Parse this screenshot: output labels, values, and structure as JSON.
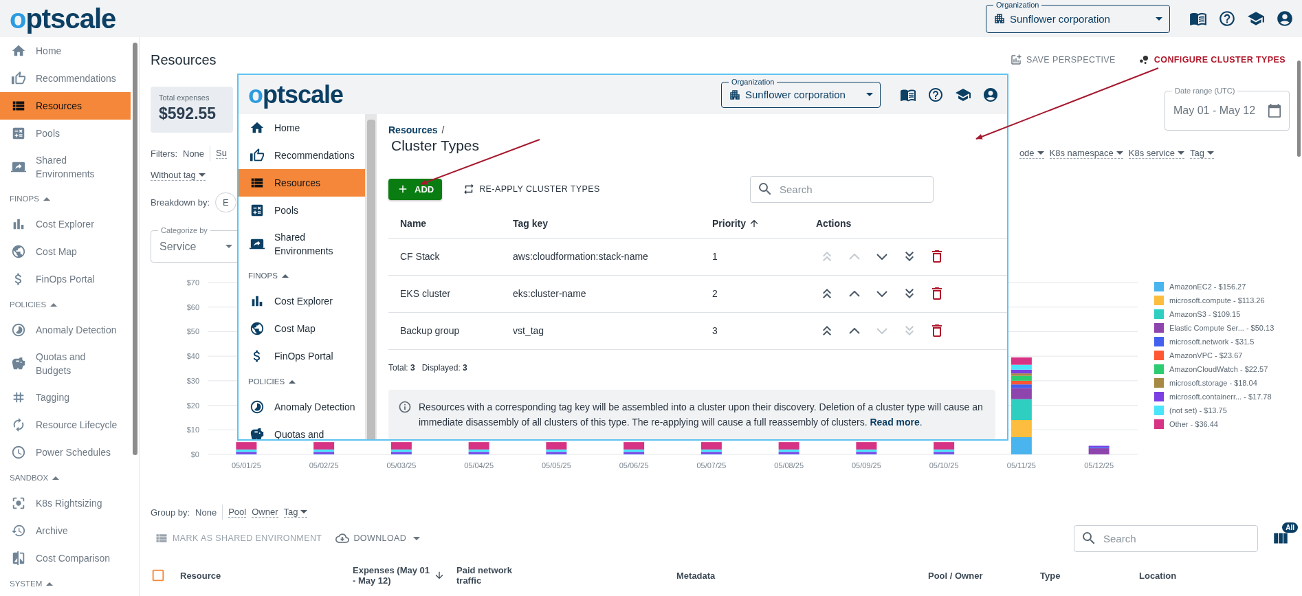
{
  "topbar": {
    "logo": "optscale",
    "organization_label": "Organization",
    "organization": "Sunflower corporation"
  },
  "sidebar": {
    "items": [
      {
        "kind": "item",
        "label": "Home",
        "selected": false
      },
      {
        "kind": "item",
        "label": "Recommendations",
        "selected": false
      },
      {
        "kind": "item",
        "label": "Resources",
        "selected": true
      },
      {
        "kind": "item",
        "label": "Pools",
        "selected": false
      },
      {
        "kind": "item",
        "label": "Shared Environments",
        "selected": false
      },
      {
        "kind": "section",
        "label": "FINOPS"
      },
      {
        "kind": "item",
        "label": "Cost Explorer",
        "selected": false
      },
      {
        "kind": "item",
        "label": "Cost Map",
        "selected": false
      },
      {
        "kind": "item",
        "label": "FinOps Portal",
        "selected": false
      },
      {
        "kind": "section",
        "label": "POLICIES"
      },
      {
        "kind": "item",
        "label": "Anomaly Detection",
        "selected": false
      },
      {
        "kind": "item",
        "label": "Quotas and Budgets",
        "selected": false
      },
      {
        "kind": "item",
        "label": "Tagging",
        "selected": false
      },
      {
        "kind": "item",
        "label": "Resource Lifecycle",
        "selected": false
      },
      {
        "kind": "item",
        "label": "Power Schedules",
        "selected": false
      },
      {
        "kind": "section",
        "label": "SANDBOX"
      },
      {
        "kind": "item",
        "label": "K8s Rightsizing",
        "selected": false
      },
      {
        "kind": "item",
        "label": "Archive",
        "selected": false
      },
      {
        "kind": "item",
        "label": "Cost Comparison",
        "selected": false
      },
      {
        "kind": "section",
        "label": "SYSTEM"
      }
    ]
  },
  "page": {
    "title": "Resources",
    "save_perspective": "SAVE PERSPECTIVE",
    "configure": "CONFIGURE CLUSTER TYPES",
    "total_expenses": {
      "label": "Total expenses",
      "value": "$592.55"
    },
    "date_range": {
      "label": "Date range (UTC)",
      "value": "May 01 - May 12"
    },
    "filters": {
      "label": "Filters:",
      "value": "None",
      "left": [
        "Su"
      ],
      "right": [
        "ode",
        "K8s namespace",
        "K8s service",
        "Tag"
      ]
    },
    "without_tag": "Without tag",
    "breakdown": {
      "label": "Breakdown by:",
      "value": "E"
    },
    "categorize": {
      "label": "Categorize by",
      "value": "Service"
    },
    "chart_data": {
      "type": "bar",
      "stacked": true,
      "ylim": [
        0,
        70
      ],
      "grid": true,
      "legend": "right",
      "categories": [
        "05/01/25",
        "05/02/25",
        "05/03/25",
        "05/04/25",
        "05/05/25",
        "05/06/25",
        "05/07/25",
        "05/08/25",
        "05/09/25",
        "05/10/25",
        "05/11/25",
        "05/12/25"
      ],
      "yticks": [
        {
          "value": 0,
          "label": "$0"
        },
        {
          "value": 10,
          "label": "$10"
        },
        {
          "value": 20,
          "label": "$20"
        },
        {
          "value": 30,
          "label": "$30"
        },
        {
          "value": 40,
          "label": "$40"
        },
        {
          "value": 50,
          "label": "$50"
        },
        {
          "value": 60,
          "label": "$60"
        },
        {
          "value": 70,
          "label": "$70"
        }
      ],
      "series": [
        {
          "name": "AmazonEC2 - $156.27",
          "color": "#4ab4ee",
          "values": [
            0,
            0,
            0,
            0,
            0,
            0,
            0,
            0,
            0,
            0,
            7,
            0
          ]
        },
        {
          "name": "microsoft.compute - $113.26",
          "color": "#fdbd3e",
          "values": [
            0,
            0,
            0,
            0,
            0,
            0,
            0,
            0,
            0,
            0,
            7,
            0
          ]
        },
        {
          "name": "AmazonS3 - $109.15",
          "color": "#2ecfc1",
          "values": [
            0,
            0,
            0,
            0,
            0,
            0,
            0,
            0,
            0,
            0,
            8.5,
            0
          ]
        },
        {
          "name": "Elastic Compute Ser... - $50.13",
          "color": "#8e44ad",
          "values": [
            0,
            0,
            0,
            0,
            0,
            0,
            0,
            0,
            0,
            0,
            4.5,
            2.5
          ]
        },
        {
          "name": "microsoft.network - $31.5",
          "color": "#4361ee",
          "values": [
            0.3,
            0.3,
            0.3,
            0.3,
            0.3,
            0.3,
            0.3,
            0.3,
            0.3,
            0.3,
            1.5,
            0.5
          ]
        },
        {
          "name": "AmazonVPC - $23.67",
          "color": "#ff5733",
          "values": [
            0,
            0,
            0,
            0,
            0,
            0,
            0,
            0,
            0,
            0,
            1.5,
            0
          ]
        },
        {
          "name": "AmazonCloudWatch - $22.57",
          "color": "#2ecc71",
          "values": [
            0,
            0,
            0,
            0,
            0,
            0,
            0,
            0,
            0,
            0,
            2,
            0
          ]
        },
        {
          "name": "microsoft.storage - $18.04",
          "color": "#a68a43",
          "values": [
            0,
            0,
            0,
            0,
            0,
            0,
            0,
            0,
            0,
            0,
            1,
            0
          ]
        },
        {
          "name": "microsoft.containerr... - $17.78",
          "color": "#7b3fe4",
          "values": [
            0.7,
            0.7,
            0.7,
            0.7,
            0.7,
            0.7,
            0.7,
            0.7,
            0.7,
            0.7,
            1.5,
            0.5
          ]
        },
        {
          "name": "(not set) - $13.75",
          "color": "#48e5fb",
          "values": [
            1,
            1,
            1,
            1,
            1,
            1,
            1,
            1,
            1,
            1,
            2,
            0
          ]
        },
        {
          "name": "Other - $36.44",
          "color": "#d63384",
          "values": [
            3,
            3,
            3,
            3,
            3,
            3,
            3,
            3,
            3,
            3,
            3,
            0
          ]
        }
      ]
    },
    "group_by": {
      "label": "Group by:",
      "value": "None",
      "options": [
        "Pool",
        "Owner",
        "Tag"
      ]
    },
    "mark_shared": "MARK AS SHARED ENVIRONMENT",
    "download": "DOWNLOAD",
    "search_placeholder": "Search",
    "columns_badge": "All",
    "select_all": {
      "checked": false
    },
    "table_columns": [
      "Resource",
      "Expenses (May 01 - May 12)",
      "Paid network traffic",
      "Metadata",
      "Pool / Owner",
      "Type",
      "Location"
    ]
  },
  "inset": {
    "logo": "optscale",
    "organization_label": "Organization",
    "organization": "Sunflower corporation",
    "sidebar": {
      "items": [
        {
          "kind": "item",
          "label": "Home",
          "selected": false
        },
        {
          "kind": "item",
          "label": "Recommendations",
          "selected": false
        },
        {
          "kind": "item",
          "label": "Resources",
          "selected": true
        },
        {
          "kind": "item",
          "label": "Pools",
          "selected": false
        },
        {
          "kind": "item",
          "label": "Shared Environments",
          "selected": false
        },
        {
          "kind": "section",
          "label": "FINOPS"
        },
        {
          "kind": "item",
          "label": "Cost Explorer",
          "selected": false
        },
        {
          "kind": "item",
          "label": "Cost Map",
          "selected": false
        },
        {
          "kind": "item",
          "label": "FinOps Portal",
          "selected": false
        },
        {
          "kind": "section",
          "label": "POLICIES"
        },
        {
          "kind": "item",
          "label": "Anomaly Detection",
          "selected": false
        },
        {
          "kind": "item",
          "label": "Quotas and",
          "selected": false
        }
      ]
    },
    "breadcrumb": "Resources",
    "breadcrumb_separator": "/",
    "title": "Cluster Types",
    "add_button": "ADD",
    "reapply_button": "RE-APPLY CLUSTER TYPES",
    "search_placeholder": "Search",
    "table": {
      "columns": [
        {
          "label": "Name",
          "sorted": false
        },
        {
          "label": "Tag key",
          "sorted": false
        },
        {
          "label": "Priority",
          "sorted": true
        },
        {
          "label": "Actions",
          "sorted": false
        }
      ],
      "rows": [
        {
          "name": "CF Stack",
          "tag_key": "aws:cloudformation:stack-name",
          "priority": "1",
          "actions": [
            {
              "kind": "top",
              "disabled": true
            },
            {
              "kind": "up",
              "disabled": true
            },
            {
              "kind": "down",
              "disabled": false
            },
            {
              "kind": "bottom",
              "disabled": false
            },
            {
              "kind": "delete",
              "disabled": false
            }
          ]
        },
        {
          "name": "EKS cluster",
          "tag_key": "eks:cluster-name",
          "priority": "2",
          "actions": [
            {
              "kind": "top",
              "disabled": false
            },
            {
              "kind": "up",
              "disabled": false
            },
            {
              "kind": "down",
              "disabled": false
            },
            {
              "kind": "bottom",
              "disabled": false
            },
            {
              "kind": "delete",
              "disabled": false
            }
          ]
        },
        {
          "name": "Backup group",
          "tag_key": "vst_tag",
          "priority": "3",
          "actions": [
            {
              "kind": "top",
              "disabled": false
            },
            {
              "kind": "up",
              "disabled": false
            },
            {
              "kind": "down",
              "disabled": true
            },
            {
              "kind": "bottom",
              "disabled": true
            },
            {
              "kind": "delete",
              "disabled": false
            }
          ]
        }
      ]
    },
    "totals": [
      "Total: **3**",
      "Displayed: **3**"
    ],
    "info": {
      "text": "Resources with a corresponding tag key will be assembled into a cluster upon their discovery. Deletion of a cluster type will cause an immediate disassembly of all clusters of this type. The re-applying will cause a full reassembly of clusters.",
      "link": "Read more",
      "suffix": "."
    }
  }
}
